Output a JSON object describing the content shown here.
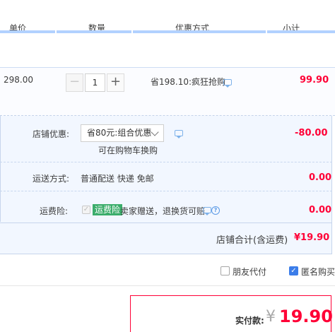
{
  "header": {
    "col_price": "单价",
    "col_qty": "数量",
    "col_promo": "优惠方式",
    "col_subtotal": "小计"
  },
  "item": {
    "unit_price": "298.00",
    "quantity": "1",
    "minus_symbol": "−",
    "plus_symbol": "+",
    "promo": "省198.10:疯狂抢购",
    "subtotal": "99.90"
  },
  "shop": {
    "discount_label": "店铺优惠:",
    "discount_selected": "省80元:组合优惠",
    "discount_hint": "可在购物车换购",
    "discount_amount": "-80.00",
    "shipping_label": "运送方式:",
    "shipping_value": "普通配送 快递 免邮",
    "shipping_amount": "0.00",
    "insurance_label": "运费险:",
    "insurance_badge": "运费险",
    "insurance_text": "卖家赠送，退换货可赔",
    "insurance_amount": "0.00",
    "total_label": "店铺合计(含运费)",
    "total_amount": "¥19.90"
  },
  "options": {
    "friend_pay": "朋友代付",
    "anonymous": "匿名购买"
  },
  "payment": {
    "label": "实付款:",
    "currency": "¥",
    "amount": "19.90"
  },
  "colors": {
    "accent_red": "#ff0036",
    "header_rule": "#b2d1ff",
    "section_bg": "#f2f7ff"
  },
  "icons": [
    "chat-icon",
    "help-icon",
    "chevron-down-icon",
    "checkmark-icon"
  ],
  "state": {
    "friend_pay_checked": false,
    "anonymous_checked": true,
    "insurance_checked": true
  }
}
